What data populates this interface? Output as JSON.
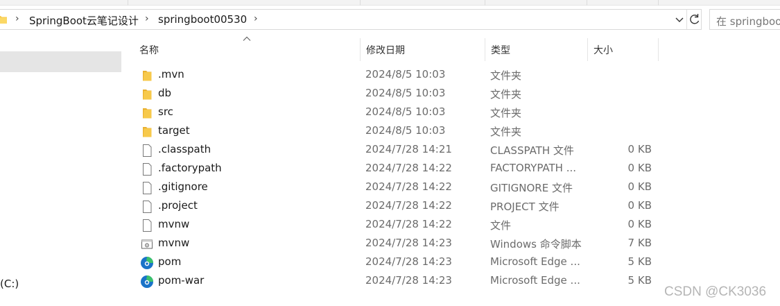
{
  "breadcrumb": {
    "items": [
      "SpringBoot云笔记设计",
      "springboot00530"
    ]
  },
  "search": {
    "placeholder": "在 springboot"
  },
  "nav": {
    "drive_label": "(C:)"
  },
  "columns": {
    "name": "名称",
    "date": "修改日期",
    "type": "类型",
    "size": "大小"
  },
  "files": [
    {
      "name": ".mvn",
      "date": "2024/8/5 10:03",
      "type": "文件夹",
      "size": "",
      "icon": "folder-icon"
    },
    {
      "name": "db",
      "date": "2024/8/5 10:03",
      "type": "文件夹",
      "size": "",
      "icon": "folder-icon"
    },
    {
      "name": "src",
      "date": "2024/8/5 10:03",
      "type": "文件夹",
      "size": "",
      "icon": "folder-icon"
    },
    {
      "name": "target",
      "date": "2024/8/5 10:03",
      "type": "文件夹",
      "size": "",
      "icon": "folder-icon"
    },
    {
      "name": ".classpath",
      "date": "2024/7/28 14:21",
      "type": "CLASSPATH 文件",
      "size": "0 KB",
      "icon": "file-icon"
    },
    {
      "name": ".factorypath",
      "date": "2024/7/28 14:22",
      "type": "FACTORYPATH ...",
      "size": "0 KB",
      "icon": "file-icon"
    },
    {
      "name": ".gitignore",
      "date": "2024/7/28 14:22",
      "type": "GITIGNORE 文件",
      "size": "0 KB",
      "icon": "file-icon"
    },
    {
      "name": ".project",
      "date": "2024/7/28 14:22",
      "type": "PROJECT 文件",
      "size": "0 KB",
      "icon": "file-icon"
    },
    {
      "name": "mvnw",
      "date": "2024/7/28 14:22",
      "type": "文件",
      "size": "0 KB",
      "icon": "file-icon"
    },
    {
      "name": "mvnw",
      "date": "2024/7/28 14:23",
      "type": "Windows 命令脚本",
      "size": "7 KB",
      "icon": "script-icon"
    },
    {
      "name": "pom",
      "date": "2024/7/28 14:23",
      "type": "Microsoft Edge ...",
      "size": "5 KB",
      "icon": "edge-icon"
    },
    {
      "name": "pom-war",
      "date": "2024/7/28 14:23",
      "type": "Microsoft Edge ...",
      "size": "5 KB",
      "icon": "edge-icon"
    }
  ],
  "watermark": "CSDN @CK3036",
  "colors": {
    "folder": "#f7c94b",
    "edge_blue": "#1a73c8",
    "edge_green": "#3cc26b",
    "selection": "#e5e5e5"
  }
}
